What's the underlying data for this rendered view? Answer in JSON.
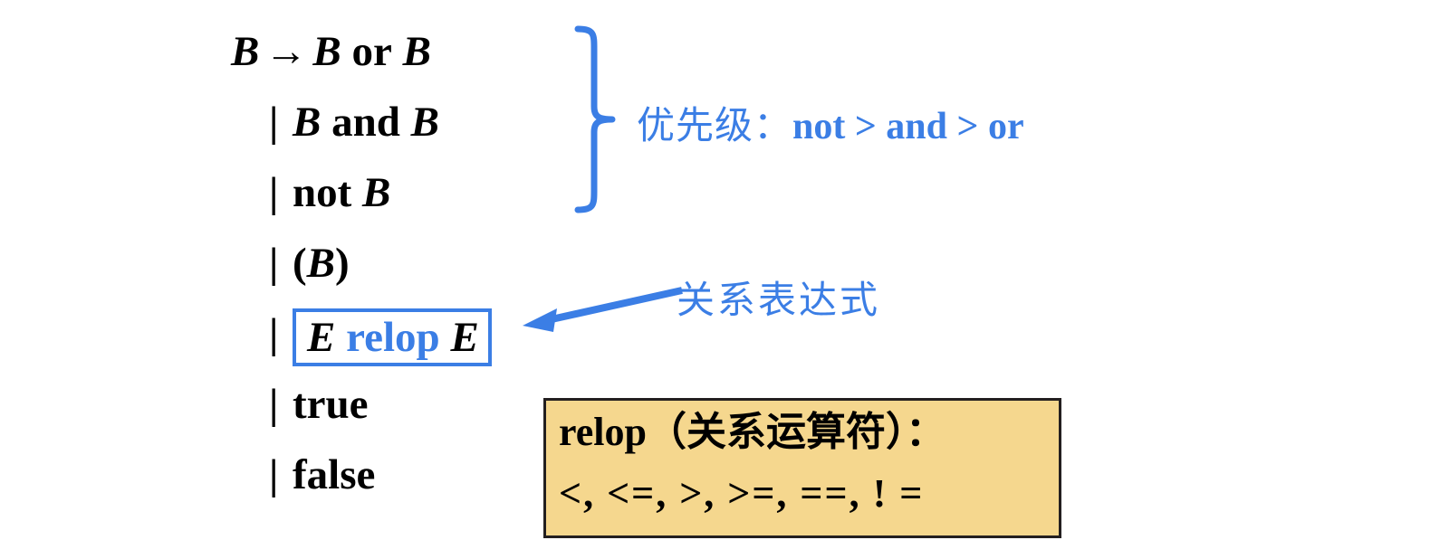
{
  "slide": {
    "background_color": "#ffffff",
    "accent_blue": "#3b7ee5",
    "text_black": "#000000",
    "legend_fill": "#f5d78e",
    "legend_border": "#231f20"
  },
  "grammar": {
    "head_symbol": "B",
    "arrow_glyph": "→",
    "alt_bar": "|",
    "productions": [
      {
        "id": "p1",
        "bar": "",
        "body": "B → B or B",
        "lhs": "B",
        "rhs_left": "B",
        "keyword": "or",
        "rhs_right": "B"
      },
      {
        "id": "p2",
        "bar": "|",
        "body": "B and B",
        "rhs_left": "B",
        "keyword": "and",
        "rhs_right": "B"
      },
      {
        "id": "p3",
        "bar": "|",
        "body": "not B",
        "keyword": "not",
        "rhs_right": "B"
      },
      {
        "id": "p4",
        "bar": "|",
        "body": "(B)",
        "open_paren": "(",
        "rhs_right": "B",
        "close_paren": ")"
      },
      {
        "id": "p5",
        "bar": "|",
        "body": "E relop E",
        "rhs_left": "E",
        "keyword": "relop",
        "rhs_right": "E",
        "highlighted": true
      },
      {
        "id": "p6",
        "bar": "|",
        "body": "true",
        "keyword": "true"
      },
      {
        "id": "p7",
        "bar": "|",
        "body": "false",
        "keyword": "false"
      }
    ]
  },
  "annotations": {
    "precedence": {
      "label_cjk": "优先级：",
      "label_ops": "not > and > or",
      "full": "优先级： not > and > or",
      "color": "#3b7ee5"
    },
    "relational_expression": {
      "label": "关系表达式",
      "color": "#3b7ee5"
    }
  },
  "legend": {
    "title_latin": "relop",
    "title_cjk": "（关系运算符）：",
    "title_full": "relop（关系运算符）：",
    "operators_text": "<, <=, >, >=, ==, ! =",
    "operators": [
      "<",
      "<=",
      ">",
      ">=",
      "==",
      "! ="
    ]
  }
}
